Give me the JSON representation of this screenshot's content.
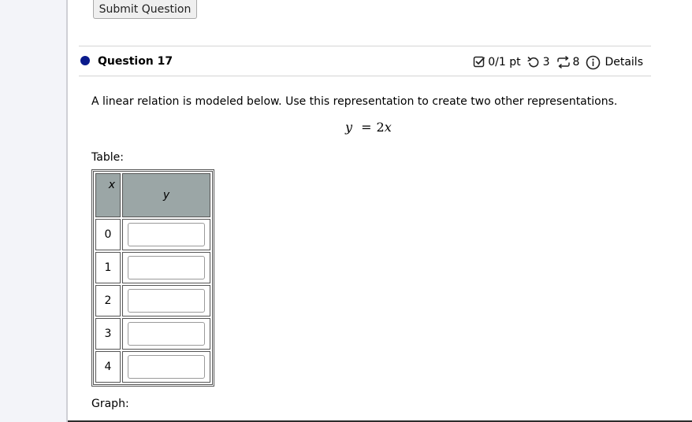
{
  "top": {
    "submit_label": "Submit Question"
  },
  "question": {
    "title": "Question 17",
    "score": "0/1 pt",
    "retries": "3",
    "attempts": "8",
    "details_label": "Details",
    "prompt": "A linear relation is modeled below. Use this representation to create two other representations.",
    "equation": {
      "lhs": "y",
      "eq": "=",
      "coef": "2",
      "var": "x"
    }
  },
  "table_section": {
    "label": "Table:",
    "headers": {
      "x": "x",
      "y": "y"
    },
    "rows": [
      {
        "x": "0",
        "y": ""
      },
      {
        "x": "1",
        "y": ""
      },
      {
        "x": "2",
        "y": ""
      },
      {
        "x": "3",
        "y": ""
      },
      {
        "x": "4",
        "y": ""
      }
    ]
  },
  "graph_section": {
    "label": "Graph:"
  },
  "colors": {
    "question_dot": "#0a1a8c",
    "table_header_bg": "#9ba6a6",
    "gutter_bg": "#f3f4f9"
  }
}
